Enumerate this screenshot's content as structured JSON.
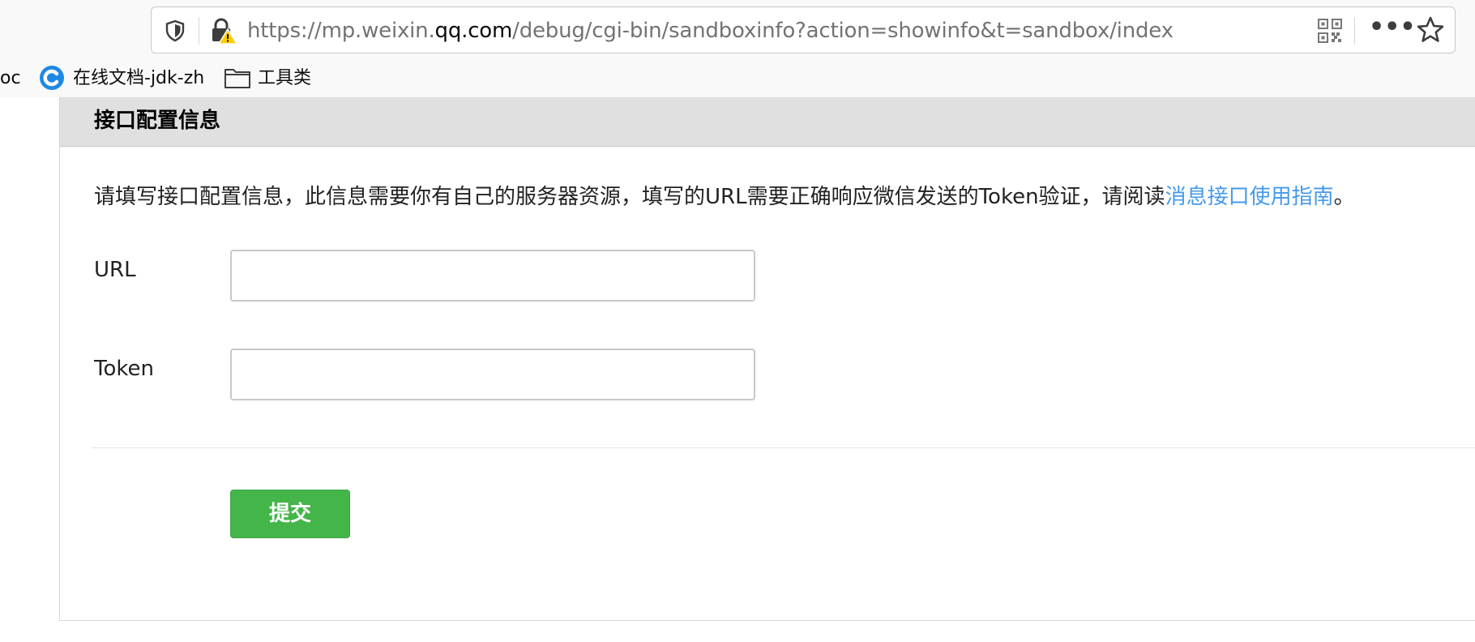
{
  "browser": {
    "url_prefix": "https://mp.weixin.",
    "url_host": "qq.com",
    "url_suffix": "/debug/cgi-bin/sandboxinfo?action=showinfo&t=sandbox/index",
    "more_label": "•••",
    "bookmarks": [
      {
        "label": "oc"
      },
      {
        "label": "在线文档-jdk-zh",
        "icon": "c-logo-icon"
      },
      {
        "label": "工具类",
        "icon": "folder-icon"
      }
    ]
  },
  "panel": {
    "title": "接口配置信息",
    "description": "请填写接口配置信息，此信息需要你有自己的服务器资源，填写的URL需要正确响应微信发送的Token验证，请阅读",
    "description_link": "消息接口使用指南",
    "description_end": "。",
    "fields": [
      {
        "label": "URL",
        "value": "",
        "placeholder": ""
      },
      {
        "label": "Token",
        "value": "",
        "placeholder": ""
      }
    ],
    "submit_label": "提交"
  },
  "colors": {
    "accent_green": "#44b549",
    "link_blue": "#459ae9",
    "header_gray": "#e0e0e0"
  }
}
